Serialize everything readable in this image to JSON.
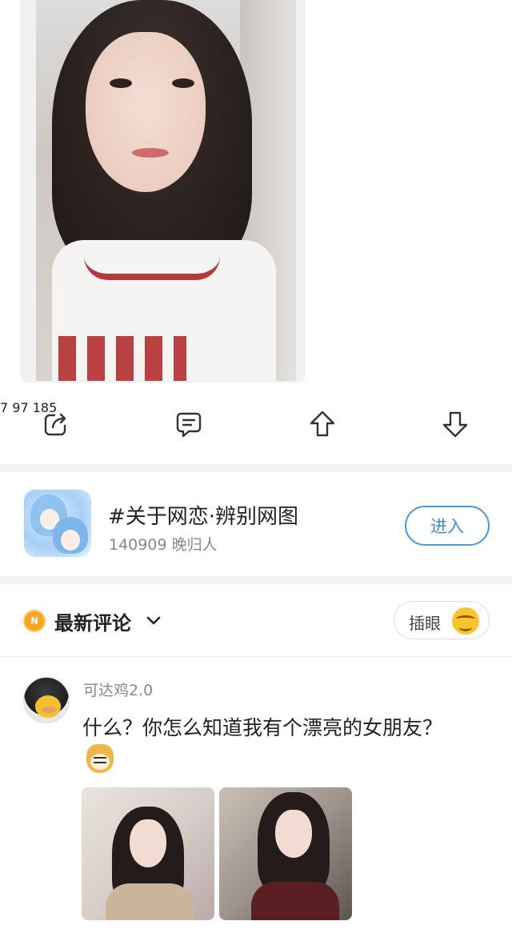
{
  "post": {
    "actions": {
      "share_count": "7",
      "comment_count": "97",
      "upvote_count": "185"
    }
  },
  "topic": {
    "title": "#关于网恋·辨别网图",
    "subtitle": "140909 晚归人",
    "join_label": "进入"
  },
  "comments_header": {
    "badge": "N",
    "title": "最新评论",
    "peek_label": "插眼"
  },
  "comment": {
    "username": "可达鸡2.0",
    "text": "什么？你怎么知道我有个漂亮的女朋友？"
  },
  "colors": {
    "accent_blue": "#3b8fd2",
    "badge_orange": "#f6a623",
    "separator": "#f2f2f6"
  },
  "icons": [
    "share-icon",
    "comment-icon",
    "upvote-icon",
    "downvote-icon",
    "chevron-down-icon",
    "sunglasses-emoji-icon",
    "doge-emoji-icon"
  ]
}
